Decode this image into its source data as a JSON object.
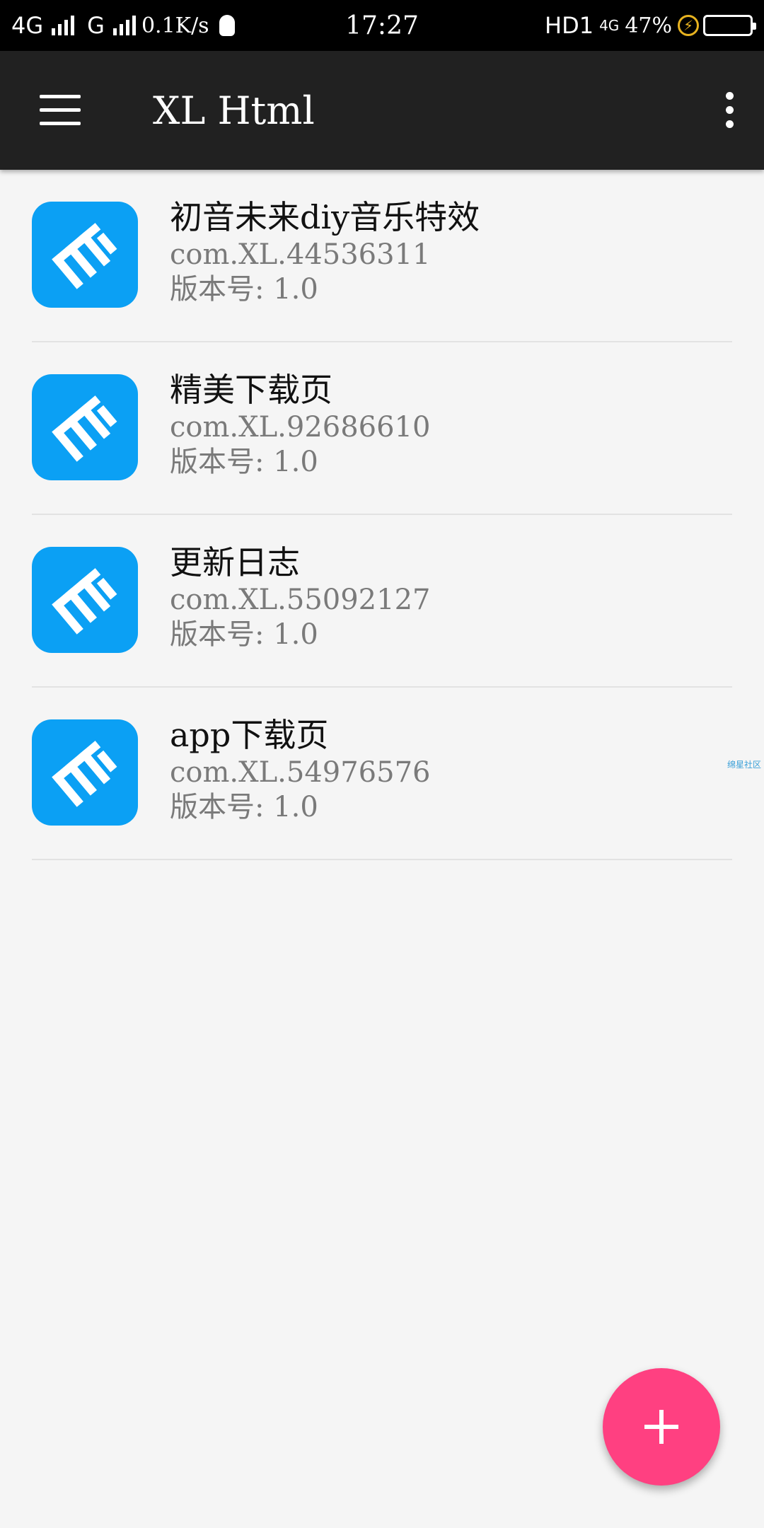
{
  "status_bar": {
    "net_left": "4G",
    "net_second": "G",
    "speed": "0.1K/s",
    "time": "17:27",
    "hd": "HD1",
    "net_right": "4G",
    "battery_pct": "47%",
    "battery_level": 0.47,
    "icons": [
      "signal-icon",
      "signal-icon",
      "qq-icon",
      "charging-icon",
      "battery-icon"
    ]
  },
  "appbar": {
    "title": "XL Html",
    "icons": [
      "menu-icon",
      "more-vert-icon"
    ]
  },
  "list": {
    "items": [
      {
        "name": "初音未来diy音乐特效",
        "package": "com.XL.44536311",
        "version": "版本号: 1.0",
        "icon": "app-icon"
      },
      {
        "name": "精美下载页",
        "package": "com.XL.92686610",
        "version": "版本号: 1.0",
        "icon": "app-icon"
      },
      {
        "name": "更新日志",
        "package": "com.XL.55092127",
        "version": "版本号: 1.0",
        "icon": "app-icon"
      },
      {
        "name": "app下载页",
        "package": "com.XL.54976576",
        "version": "版本号: 1.0",
        "icon": "app-icon"
      }
    ]
  },
  "watermark": "绵星社区",
  "fab": {
    "icon": "plus-icon"
  },
  "colors": {
    "statusbar_bg": "#000000",
    "appbar_bg": "#212121",
    "page_bg": "#f5f5f5",
    "icon_bg": "#0ba0f4",
    "fab_bg": "#ff4081",
    "battery_fill": "#4cd964"
  }
}
